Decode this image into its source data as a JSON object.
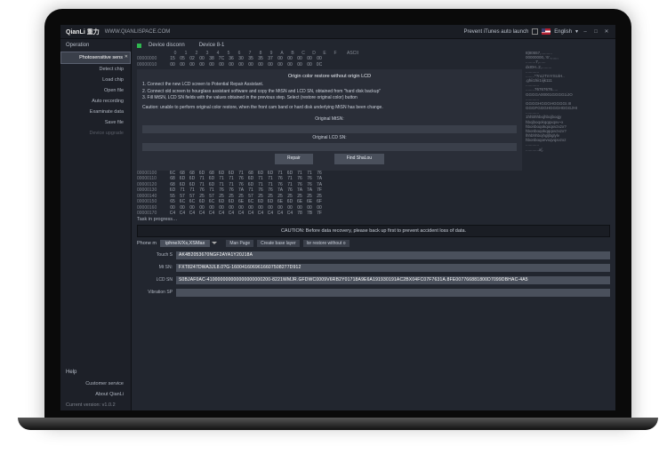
{
  "titlebar": {
    "logo": "QianLi 重力",
    "url": "WWW.QIANLISPACE.COM",
    "prevent_label": "Prevent iTunes auto launch",
    "lang_label": "English",
    "caret": "▾",
    "min": "–",
    "max": "□",
    "close": "✕"
  },
  "sidebar": {
    "head1": "Operation",
    "items": [
      "Photosensitive sens",
      "Detect chip",
      "Load chip",
      "Open file",
      "Auto recording",
      "Examinate data",
      "Save file",
      "Device upgrade"
    ],
    "head2": "Help",
    "items2": [
      "Customer service",
      "About QianLi"
    ],
    "version": "Current version: v1.0.2"
  },
  "device": {
    "disconnect": "Device disconn",
    "name": "Device 8-1"
  },
  "hex_cols": [
    "0",
    "1",
    "2",
    "3",
    "4",
    "5",
    "6",
    "7",
    "8",
    "9",
    "A",
    "B",
    "C",
    "D",
    "E",
    "F"
  ],
  "hex_ascii_head": "ASCII",
  "instr": {
    "title": "Origin color restore without origin LCD",
    "l1": "1. Connect the new LCD screen to Potential Repair Assistant.",
    "l2": "2. Connect old screen to hourglass assistant software and copy the MtSN and LCD SN, obtained from \"hard disk backup\"",
    "l3": "3. Fill MtSN, LCD SN fields with the values obtained in the previous step. Select (restore original color) button",
    "caution": "Caution: unable to perform original color restore, when the front cam band or hard disk underlying MtSN has been change."
  },
  "fields": {
    "mtsn_label": "Original MtSN:",
    "lcdsn_label": "Original LCD SN:"
  },
  "buttons": {
    "repair": "Repair",
    "find": "Find ShaLou"
  },
  "hex_rows": [
    {
      "addr": "00000100",
      "b": [
        "6C",
        "68",
        "68",
        "6D",
        "68",
        "6D",
        "6D",
        "71",
        "68",
        "6D",
        "6D",
        "71",
        "6D",
        "71",
        "71",
        "76"
      ]
    },
    {
      "addr": "00000110",
      "b": [
        "68",
        "6D",
        "6D",
        "71",
        "6D",
        "71",
        "71",
        "76",
        "6D",
        "71",
        "71",
        "76",
        "71",
        "76",
        "76",
        "7A"
      ]
    },
    {
      "addr": "00000120",
      "b": [
        "68",
        "6D",
        "6D",
        "71",
        "6D",
        "71",
        "71",
        "76",
        "6D",
        "71",
        "71",
        "76",
        "71",
        "76",
        "76",
        "7A"
      ]
    },
    {
      "addr": "00000130",
      "b": [
        "6D",
        "71",
        "71",
        "76",
        "71",
        "76",
        "76",
        "7A",
        "71",
        "76",
        "76",
        "7A",
        "76",
        "7A",
        "7A",
        "7F"
      ]
    },
    {
      "addr": "00000140",
      "b": [
        "55",
        "57",
        "57",
        "25",
        "57",
        "25",
        "25",
        "25",
        "57",
        "25",
        "25",
        "25",
        "25",
        "25",
        "25",
        "25"
      ]
    },
    {
      "addr": "00000150",
      "b": [
        "65",
        "6C",
        "6C",
        "6D",
        "6C",
        "6D",
        "6D",
        "6E",
        "6C",
        "6D",
        "6D",
        "6E",
        "6D",
        "6E",
        "6E",
        "6F"
      ]
    },
    {
      "addr": "00000160",
      "b": [
        "00",
        "00",
        "00",
        "00",
        "00",
        "00",
        "00",
        "00",
        "00",
        "00",
        "00",
        "00",
        "00",
        "00",
        "00",
        "00"
      ]
    },
    {
      "addr": "00000170",
      "b": [
        "C4",
        "C4",
        "C4",
        "C4",
        "C4",
        "C4",
        "C4",
        "C4",
        "C4",
        "C4",
        "C4",
        "C4",
        "C4",
        "78",
        "7B",
        "7F"
      ]
    }
  ],
  "ascii_lines": [
    "8|80557,..........",
    "00000000,.'6'.,,,,,,,",
    ".........7,......",
    "dxI0H..2,.........",
    "............",
    "........*?nczTmYSUiH..",
    ".ghii1hii1iijk111",
    "............",
    "........76767676.....",
    "GGGGA00001GGGG1iJO",
    "............",
    "GGGGHGGGHGGGGI.III",
    "GGGFGGGHGGGHGGGJHI",
    "............",
    "1hhbhhbojhbojboqjy",
    "hbojboqokqqqxqxv~x",
    "hbonboqokqoqxvzxzx?",
    "hbonboqokqqqxvzxzx?",
    "lhhbhhbojhgljbglylv",
    "hbonboqoevxqvqxvzxz",
    "............",
    "............x{."
  ],
  "hex_top": [
    {
      "addr": "00000000",
      "b": [
        "15",
        "05",
        "02",
        "00",
        "38",
        "7C",
        "36",
        "30",
        "35",
        "35",
        "37",
        "00",
        "00",
        "00",
        "00",
        "00"
      ]
    },
    {
      "addr": "00000010",
      "b": [
        "00",
        "00",
        "00",
        "00",
        "00",
        "00",
        "00",
        "00",
        "00",
        "00",
        "00",
        "00",
        "00",
        "00",
        "00",
        "0C"
      ]
    }
  ],
  "task": "Task in progress…",
  "caution_bar": "CAUTION: Before data recovery, please back up first to prevent accident loss of data.",
  "phone_row": {
    "label": "Phone m",
    "select": "iphneX/Xs,XSMax",
    "btns": [
      "Man Page",
      "Create base layer",
      "lor restore without o"
    ]
  },
  "sn": {
    "touch": {
      "label": "Touch S",
      "value": "AK4B2053670NGF2AYA1Y20J18A"
    },
    "mt": {
      "label": "Mt SN:",
      "value": "FXT8247DWA3JL8.0?G-1600416069616607508277D912"
    },
    "lcd": {
      "label": "LCD SN",
      "value": "S0BJAF0AC-410000000000000000000200-8221WMJR.GFDWC0009V6RB2Y01718A9E6A191930191AC2BX04FC07F7631A.8FE007766881800D7099DBHAC-4A5"
    },
    "vib": {
      "label": "Vibration SP",
      "value": ""
    }
  }
}
